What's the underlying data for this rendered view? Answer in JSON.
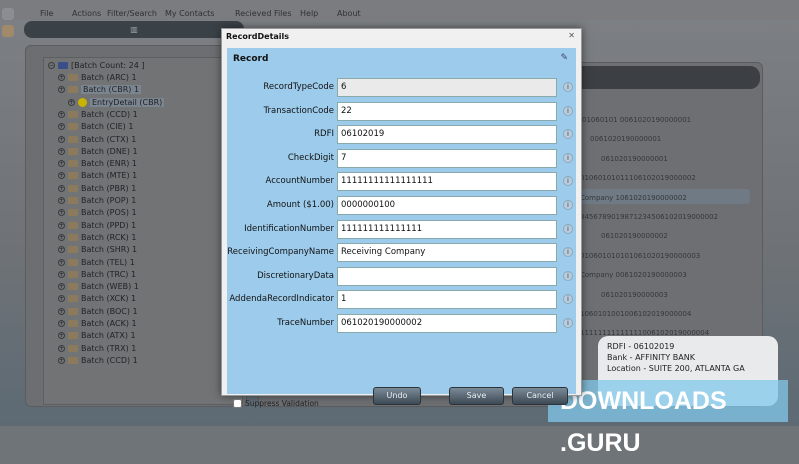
{
  "menu": [
    "File",
    "Actions",
    "Filter/Search",
    "My Contacts",
    "Recieved Files",
    "Help",
    "About"
  ],
  "toolbar_icon": "chart-icon",
  "tree": {
    "root": "[Batch Count: 24 ]",
    "items": [
      {
        "label": "Batch (ARC) 1",
        "level": 1
      },
      {
        "label": "Batch (CBR) 1",
        "level": 1,
        "selected": true
      },
      {
        "label": "EntryDetail (CBR)",
        "level": 2,
        "selected": true
      },
      {
        "label": "Batch (CCD) 1",
        "level": 1
      },
      {
        "label": "Batch (CIE) 1",
        "level": 1
      },
      {
        "label": "Batch (CTX) 1",
        "level": 1
      },
      {
        "label": "Batch (DNE) 1",
        "level": 1
      },
      {
        "label": "Batch (ENR) 1",
        "level": 1
      },
      {
        "label": "Batch (MTE) 1",
        "level": 1
      },
      {
        "label": "Batch (PBR) 1",
        "level": 1
      },
      {
        "label": "Batch (POP) 1",
        "level": 1
      },
      {
        "label": "Batch (POS) 1",
        "level": 1
      },
      {
        "label": "Batch (PPD) 1",
        "level": 1
      },
      {
        "label": "Batch (RCK) 1",
        "level": 1
      },
      {
        "label": "Batch (SHR) 1",
        "level": 1
      },
      {
        "label": "Batch (TEL) 1",
        "level": 1
      },
      {
        "label": "Batch (TRC) 1",
        "level": 1
      },
      {
        "label": "Batch (WEB) 1",
        "level": 1
      },
      {
        "label": "Batch (XCK) 1",
        "level": 1
      },
      {
        "label": "Batch (BOC) 1",
        "level": 1
      },
      {
        "label": "Batch (ACK) 1",
        "level": 1
      },
      {
        "label": "Batch (ATX) 1",
        "level": 1
      },
      {
        "label": "Batch (TRX) 1",
        "level": 1
      },
      {
        "label": "Batch (CCD) 1",
        "level": 1
      }
    ]
  },
  "right_rows": [
    "01060101   0061020190000001",
    "0061020190000001",
    "061020190000001",
    "01060101011106102019000002",
    "Company        1061020190000002",
    "3456789019871234506102019000002",
    "061020190000002",
    "010601010101061020190000003",
    "Company        0061020190000003",
    "061020190000003",
    "1060101001006102019000004",
    "11111111111111006102019000004"
  ],
  "tooltip": {
    "rdfi": "RDFI     - 06102019",
    "bank": "Bank     - AFFINITY BANK",
    "location": "Location - SUITE 200, ATLANTA GA"
  },
  "watermark": "DOWNLOADS .GURU",
  "dialog": {
    "title": "RecordDetails",
    "close": "✕",
    "section": "Record",
    "fields": [
      {
        "label": "RecordTypeCode",
        "value": "6",
        "readonly": true
      },
      {
        "label": "TransactionCode",
        "value": "22"
      },
      {
        "label": "RDFI",
        "value": "06102019"
      },
      {
        "label": "CheckDigit",
        "value": "7"
      },
      {
        "label": "AccountNumber",
        "value": "11111111111111111"
      },
      {
        "label": "Amount ($1.00)",
        "value": "0000000100"
      },
      {
        "label": "IdentificationNumber",
        "value": "111111111111111"
      },
      {
        "label": "ReceivingCompanyName",
        "value": "Receiving Company"
      },
      {
        "label": "DiscretionaryData",
        "value": ""
      },
      {
        "label": "AddendaRecordIndicator",
        "value": "1"
      },
      {
        "label": "TraceNumber",
        "value": "061020190000002"
      }
    ],
    "suppress_validation": "Suppress Validation",
    "undo": "Undo",
    "save": "Save",
    "cancel": "Cancel"
  }
}
